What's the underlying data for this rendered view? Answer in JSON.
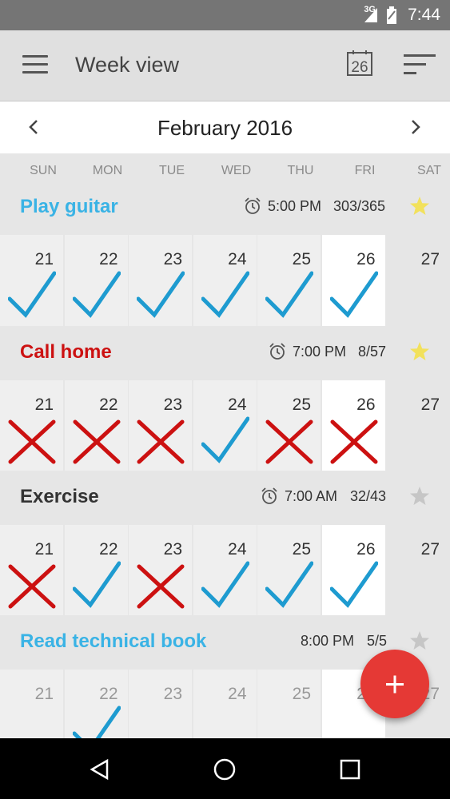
{
  "status_bar": {
    "time": "7:44",
    "network": "3G"
  },
  "app_bar": {
    "title": "Week view",
    "today_date": "26"
  },
  "month_bar": {
    "label": "February 2016"
  },
  "weekdays": [
    "SUN",
    "MON",
    "TUE",
    "WED",
    "THU",
    "FRI",
    "SAT"
  ],
  "habits": [
    {
      "name": "Play guitar",
      "color": "#3ab3e5",
      "show_alarm": true,
      "reminder": "5:00 PM",
      "score": "303/365",
      "starred": true,
      "days": [
        {
          "num": "21",
          "mark": "check"
        },
        {
          "num": "22",
          "mark": "check"
        },
        {
          "num": "23",
          "mark": "check"
        },
        {
          "num": "24",
          "mark": "check"
        },
        {
          "num": "25",
          "mark": "check"
        },
        {
          "num": "26",
          "mark": "check"
        },
        {
          "num": "27",
          "mark": "none"
        }
      ]
    },
    {
      "name": "Call home",
      "color": "#cc1111",
      "show_alarm": true,
      "reminder": "7:00 PM",
      "score": "8/57",
      "starred": true,
      "days": [
        {
          "num": "21",
          "mark": "cross"
        },
        {
          "num": "22",
          "mark": "cross"
        },
        {
          "num": "23",
          "mark": "cross"
        },
        {
          "num": "24",
          "mark": "check"
        },
        {
          "num": "25",
          "mark": "cross"
        },
        {
          "num": "26",
          "mark": "cross"
        },
        {
          "num": "27",
          "mark": "none"
        }
      ]
    },
    {
      "name": "Exercise",
      "color": "#333333",
      "show_alarm": true,
      "reminder": "7:00 AM",
      "score": "32/43",
      "starred": false,
      "days": [
        {
          "num": "21",
          "mark": "cross"
        },
        {
          "num": "22",
          "mark": "check"
        },
        {
          "num": "23",
          "mark": "cross"
        },
        {
          "num": "24",
          "mark": "check"
        },
        {
          "num": "25",
          "mark": "check"
        },
        {
          "num": "26",
          "mark": "check"
        },
        {
          "num": "27",
          "mark": "none"
        }
      ]
    },
    {
      "name": "Read technical book",
      "color": "#3ab3e5",
      "show_alarm": false,
      "reminder": "8:00 PM",
      "score": "5/5",
      "starred": false,
      "days": [
        {
          "num": "21",
          "mark": "none"
        },
        {
          "num": "22",
          "mark": "check"
        },
        {
          "num": "23",
          "mark": "none"
        },
        {
          "num": "24",
          "mark": "none"
        },
        {
          "num": "25",
          "mark": "none"
        },
        {
          "num": "26",
          "mark": "none"
        },
        {
          "num": "27",
          "mark": "none"
        }
      ]
    }
  ],
  "fab": {
    "icon": "plus-icon"
  },
  "colors": {
    "check": "#1e9bd0",
    "cross": "#cc1111",
    "star_on": "#f2e15c",
    "star_off": "#c6c6c6",
    "fab": "#e53935"
  }
}
